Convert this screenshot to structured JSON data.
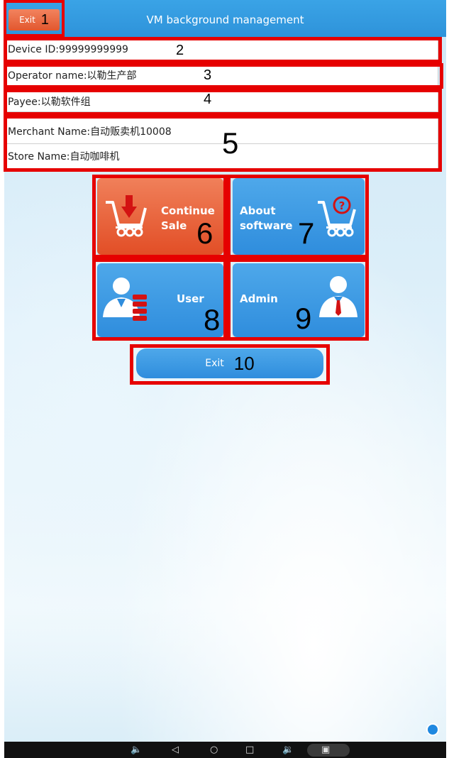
{
  "header": {
    "title": "VM background management",
    "exit_label": "Exit"
  },
  "info": {
    "device_id": "Device ID:99999999999",
    "operator_name": "Operator name:以勒生产部",
    "payee": "Payee:以勒软件组",
    "merchant_name": "Merchant Name:自动贩卖机10008",
    "store_name": "Store Name:自动咖啡机"
  },
  "tiles": {
    "continue_sale": "Continue Sale",
    "about_software": "About software",
    "user": "User",
    "admin": "Admin"
  },
  "footer": {
    "exit_label": "Exit"
  },
  "annotations": [
    "1",
    "2",
    "3",
    "4",
    "5",
    "6",
    "7",
    "8",
    "9",
    "10"
  ],
  "colors": {
    "accent_blue": "#2f8ddd",
    "accent_orange": "#e24e26",
    "annotation_red": "#e60000"
  },
  "icons": {
    "continue_sale": "cart-download-icon",
    "about_software": "cart-question-icon",
    "user": "user-list-icon",
    "admin": "admin-tie-icon"
  }
}
